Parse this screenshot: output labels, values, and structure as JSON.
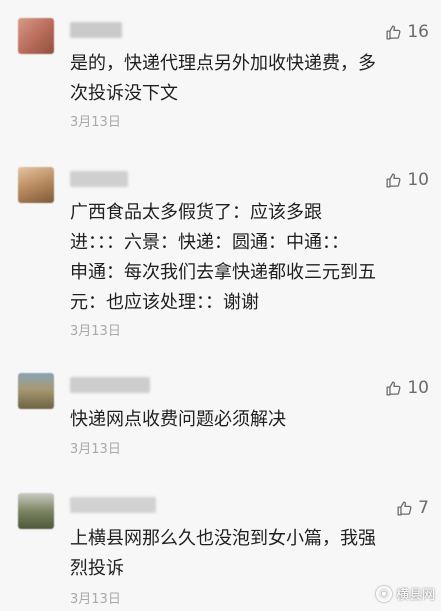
{
  "comments": [
    {
      "likes": "16",
      "text": "是的，快递代理点另外加收快递费，多\n次投诉没下文",
      "date": "3月13日",
      "avatar_color": "#b86a58",
      "name_color": "#c9c9c9"
    },
    {
      "likes": "10",
      "text": "广西食品太多假货了：应该多跟\n进：：：六景：快递：圆通：中通：：\n申通：每次我们去拿快递都收三元到五\n元：也应该处理：：谢谢",
      "date": "3月13日",
      "avatar_color": "#b98a5f",
      "name_color": "#cfcfcf"
    },
    {
      "likes": "10",
      "text": "快递网点收费问题必须解决",
      "date": "3月13日",
      "avatar_color": "#8a7a55",
      "name_color": "#cdcdcd"
    },
    {
      "likes": "7",
      "text": "上横县网那么久也没泡到女小篇，我强\n烈投诉",
      "date": "3月13日",
      "avatar_color": "#6f7760",
      "name_color": "#d2d2d2"
    }
  ],
  "watermark": {
    "text": "横县网"
  }
}
